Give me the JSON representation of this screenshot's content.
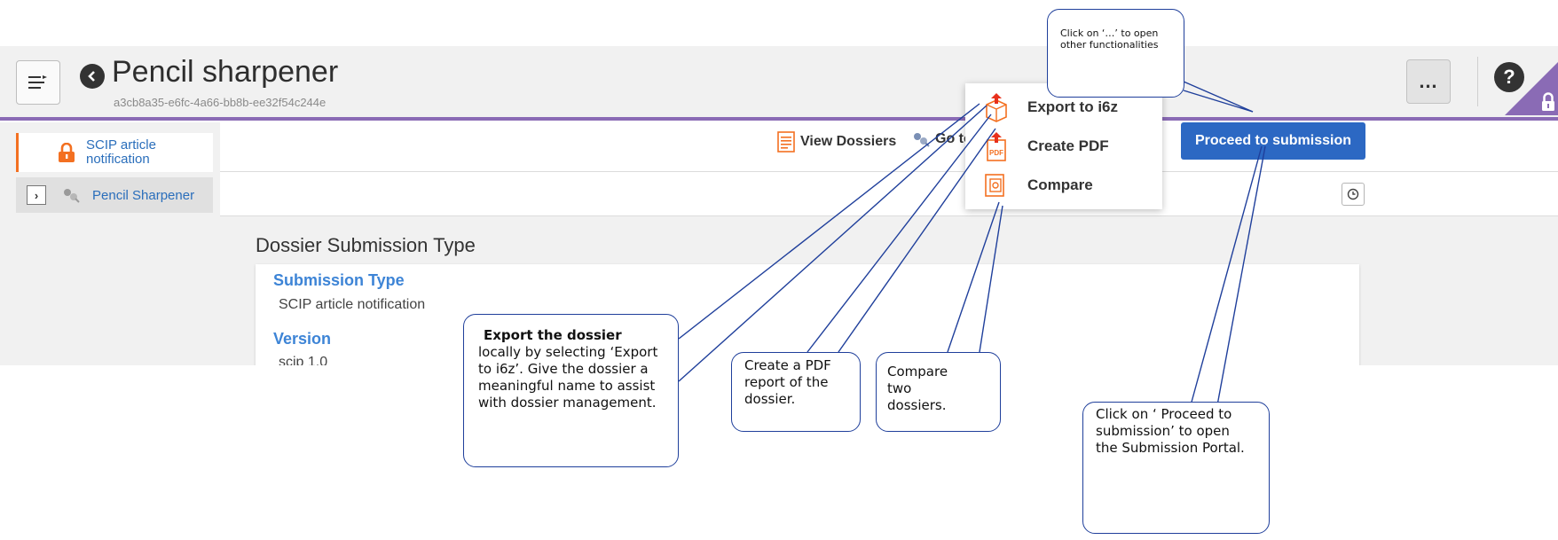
{
  "header": {
    "title": "Pencil sharpener",
    "uuid": "a3cb8a35-e6fc-4a66-bb8b-ee32f54c244e",
    "more_label": "…",
    "help_label": "?"
  },
  "sidebar": {
    "items": [
      {
        "label": "SCIP article notification",
        "icon": "lock-icon"
      },
      {
        "label": "Pencil Sharpener",
        "icon": "pushpin-icon",
        "expander": "›"
      }
    ]
  },
  "toolbar": {
    "view_dossiers_label": "View Dossiers",
    "goto_label": "Go to",
    "proceed_label": "Proceed to submission"
  },
  "main": {
    "section_title": "Dossier Submission Type",
    "fields": [
      {
        "label": "Submission Type",
        "value": "SCIP article notification"
      },
      {
        "label": "Version",
        "value": "scip 1.0"
      }
    ]
  },
  "dropdown": {
    "items": [
      {
        "label": "Export to i6z",
        "icon": "export-icon"
      },
      {
        "label": "Create PDF",
        "icon": "pdf-icon"
      },
      {
        "label": "Compare",
        "icon": "compare-icon"
      }
    ]
  },
  "callouts": {
    "more": "Click on ‘…’ to open other functionalities",
    "export_bold": "Export the dossier",
    "export_rest": "locally by selecting ‘Export to i6z’. Give the dossier a meaningful name to assist with dossier management.",
    "pdf": "Create a PDF report of the dossier.",
    "compare": "Compare two dossiers.",
    "proceed": "Click on ‘ Proceed to submission’ to open the Submission Portal."
  },
  "colors": {
    "accent_purple": "#8a6bb5",
    "primary_button": "#2c68c3",
    "field_label_blue": "#3d84d6",
    "callout_border": "#1f3f9b",
    "icon_orange": "#f37021"
  }
}
